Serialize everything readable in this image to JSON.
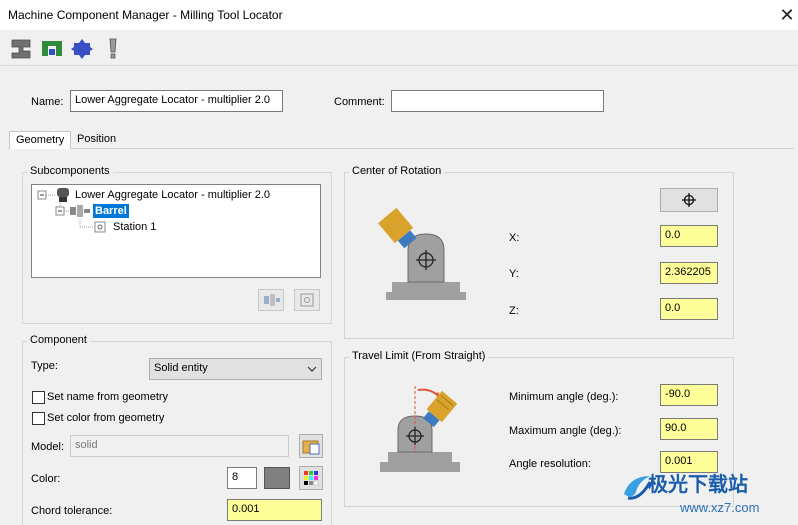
{
  "window": {
    "title": "Machine Component Manager - Milling Tool Locator",
    "close_glyph": "✕"
  },
  "toolbar": {
    "icons": [
      "component-icon",
      "locator-icon",
      "gear-component-icon",
      "warning-icon"
    ]
  },
  "name_field": {
    "label": "Name:",
    "value": "Lower Aggregate Locator - multiplier 2.0"
  },
  "comment_field": {
    "label": "Comment:",
    "value": ""
  },
  "tabs": [
    {
      "label": "Geometry",
      "active": true
    },
    {
      "label": "Position",
      "active": false
    }
  ],
  "subcomponents": {
    "title": "Subcomponents",
    "tree": [
      {
        "label": "Lower Aggregate Locator - multiplier 2.0",
        "level": 0
      },
      {
        "label": "Barrel",
        "level": 1,
        "selected": true
      },
      {
        "label": "Station 1",
        "level": 2
      }
    ]
  },
  "component": {
    "title": "Component",
    "type_label": "Type:",
    "type_value": "Solid entity",
    "set_name_label": "Set name from geometry",
    "set_color_label": "Set color from geometry",
    "model_label": "Model:",
    "model_value": "solid",
    "color_label": "Color:",
    "color_value": "8",
    "color_swatch": "#808080",
    "chord_label": "Chord tolerance:",
    "chord_value": "0.001"
  },
  "center_of_rotation": {
    "title": "Center of Rotation",
    "x_label": "X:",
    "x_value": "0.0",
    "y_label": "Y:",
    "y_value": "2.362205",
    "z_label": "Z:",
    "z_value": "0.0"
  },
  "travel_limit": {
    "title": "Travel Limit (From Straight)",
    "min_label": "Minimum angle (deg.):",
    "min_value": "-90.0",
    "max_label": "Maximum angle (deg.):",
    "max_value": "90.0",
    "res_label": "Angle resolution:",
    "res_value": "0.001"
  },
  "watermark": {
    "text": "极光下载站",
    "sub": "www.xz7.com"
  },
  "colors": {
    "input_highlight": "#ffff99",
    "selection": "#0078d7",
    "tool_orange": "#d9a32b",
    "tool_blue": "#3c7bc0",
    "base_gray": "#a0a0a0",
    "arrow_red": "#e0553a"
  }
}
